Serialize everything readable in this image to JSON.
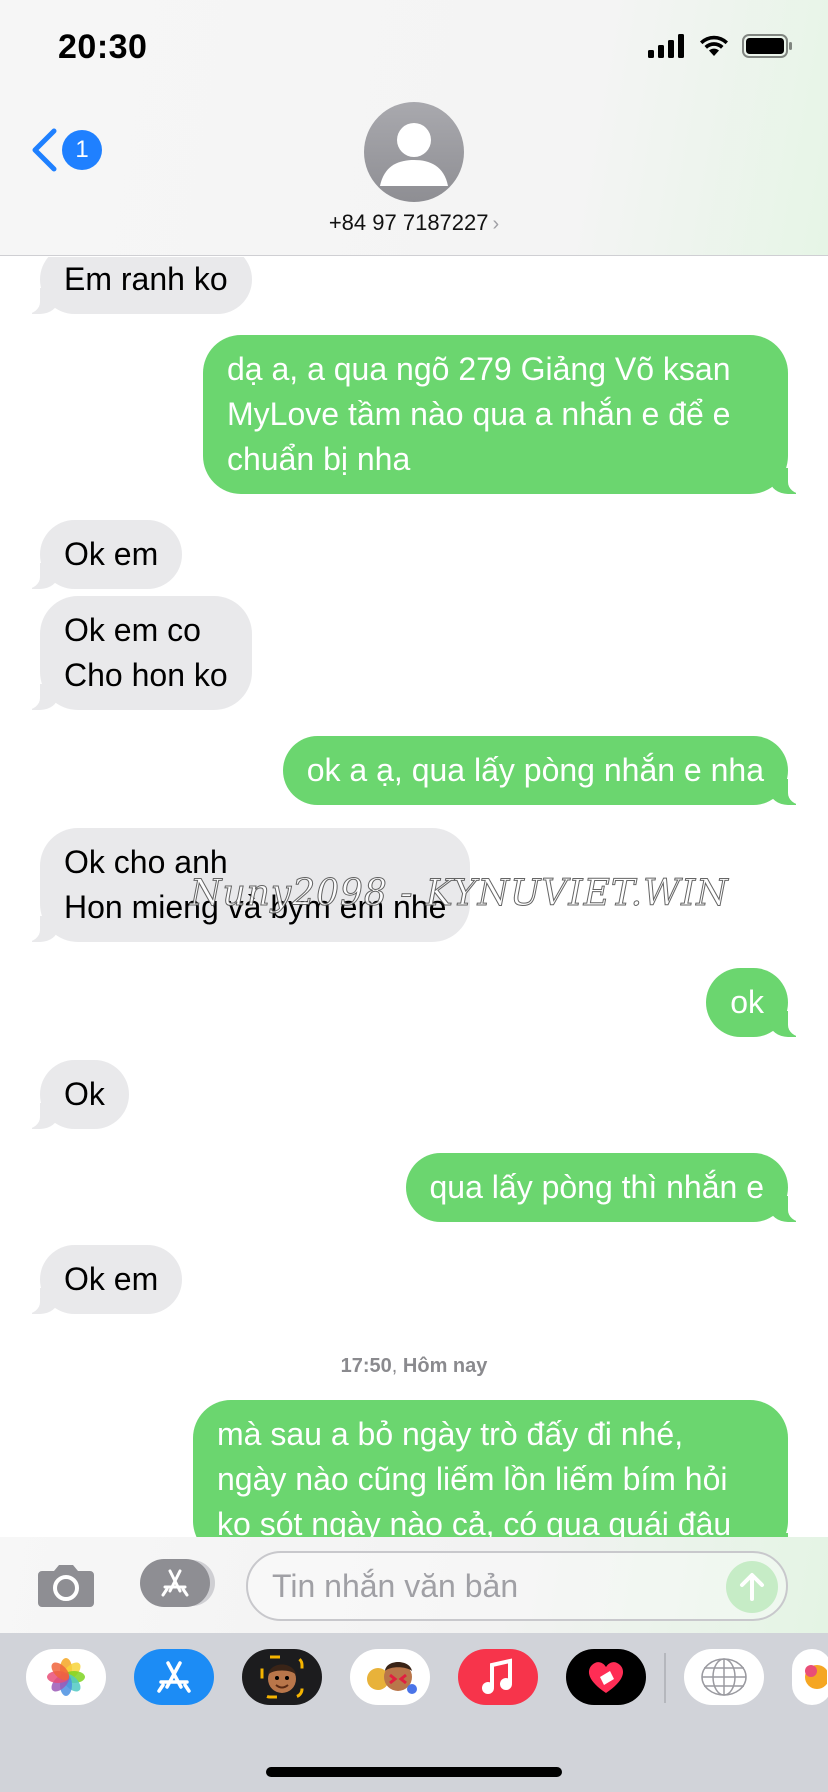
{
  "status_bar": {
    "time": "20:30"
  },
  "header": {
    "back_badge": "1",
    "contact": "+84 97 7187227",
    "chevron": "›"
  },
  "messages": [
    {
      "dir": "in",
      "text": "Em ranh ko"
    },
    {
      "dir": "out",
      "text": "dạ a, a qua ngõ 279 Giảng Võ ksan\nMyLove tầm nào qua a nhắn e để e\nchuẩn bị nha"
    },
    {
      "dir": "in",
      "text": "Ok em"
    },
    {
      "dir": "in",
      "text": "Ok em co\nCho hon ko"
    },
    {
      "dir": "out",
      "text": "ok a ạ, qua lấy pòng nhắn e nha"
    },
    {
      "dir": "in",
      "text": "Ok cho anh\nHon mieng và bym em nhe"
    },
    {
      "dir": "out",
      "text": "ok"
    },
    {
      "dir": "in",
      "text": "Ok"
    },
    {
      "dir": "out",
      "text": "qua lấy pòng thì nhắn e"
    },
    {
      "dir": "in",
      "text": "Ok em"
    },
    {
      "dir": "out",
      "text": "mà sau a bỏ ngày trò đấy đi nhé,\nngày nào cũng liếm lồn liếm bím hỏi\nko sót ngày nào cả, có qua quái đâu"
    }
  ],
  "timestamp": {
    "time": "17:50",
    "day": "Hôm nay"
  },
  "watermark": "Nuny2098 - KYNUVIET.WIN",
  "input": {
    "placeholder": "Tin nhắn văn bản",
    "value": ""
  },
  "app_drawer": {
    "apps": [
      "photos-app",
      "app-store-app",
      "memoji-app",
      "animoji-app",
      "music-app",
      "digital-touch-app",
      "gif-search-app"
    ]
  },
  "colors": {
    "outgoing_bubble": "#6bd66f",
    "incoming_bubble": "#e9e9eb",
    "accent": "#1f80ff",
    "timestamp": "#8a8a8e"
  }
}
